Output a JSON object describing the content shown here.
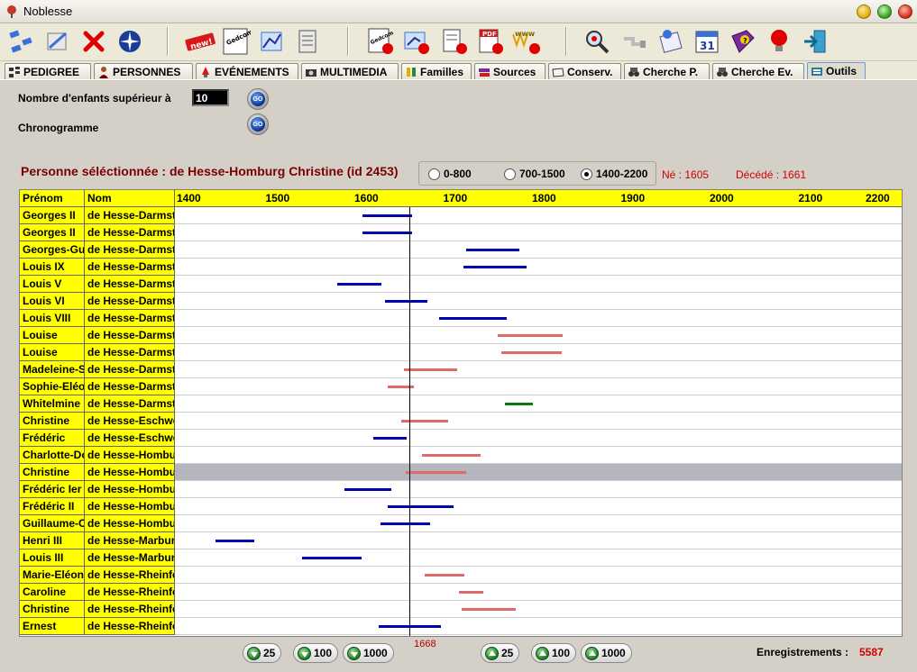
{
  "window": {
    "title": "Noblesse"
  },
  "colors": {
    "male": "#0000b4",
    "female": "#e06a6a",
    "unknown": "#0a7a0a",
    "header": "#ffff00",
    "highlight": "#b5b5bd"
  },
  "toolbar": {
    "icons": [
      "network-icon",
      "edit-tree-icon",
      "delete-icon",
      "compass-icon",
      "new-icon",
      "gedcom-icon",
      "chart-icon",
      "document-edit-icon",
      "gedcom-export-icon",
      "gedcom-import-icon",
      "print-icon",
      "pdf-icon",
      "www-icon",
      "search-icon",
      "link-icon",
      "note-icon",
      "calendar-icon",
      "help-book-icon",
      "tip-icon",
      "exit-icon"
    ],
    "new_label": "new!",
    "gedcom_label": "Gedcom",
    "pdf_label": "PDF",
    "www_label": "www",
    "calendar_label": "31"
  },
  "tabs": [
    {
      "label": "PEDIGREE",
      "icon": "pedigree-icon"
    },
    {
      "label": "PERSONNES",
      "icon": "person-icon"
    },
    {
      "label": "EVÉNEMENTS",
      "icon": "event-icon"
    },
    {
      "label": "MULTIMEDIA",
      "icon": "camera-icon"
    },
    {
      "label": "Familles",
      "icon": "family-icon"
    },
    {
      "label": "Sources",
      "icon": "books-icon"
    },
    {
      "label": "Conserv.",
      "icon": "folder-icon"
    },
    {
      "label": "Cherche P.",
      "icon": "binoculars-icon"
    },
    {
      "label": "Cherche Ev.",
      "icon": "binoculars-icon"
    },
    {
      "label": "Outils",
      "icon": "tools-icon",
      "active": true
    }
  ],
  "tools": {
    "children_label": "Nombre d'enfants supérieur à",
    "children_value": "10",
    "go_label": "GO",
    "chrono_label": "Chronogramme"
  },
  "selection": {
    "title": "Personne séléctionnée : de Hesse-Homburg Christine (id 2453)",
    "ranges": [
      {
        "label": "0-800",
        "checked": false
      },
      {
        "label": "700-1500",
        "checked": false
      },
      {
        "label": "1400-2200",
        "checked": true
      }
    ],
    "born": "Né : 1605",
    "died": "Décédé : 1661"
  },
  "chart_data": {
    "type": "gantt",
    "columns": {
      "first_name": "Prénom",
      "last_name": "Nom"
    },
    "xlim": [
      1400,
      2200
    ],
    "ticks": [
      1400,
      1500,
      1600,
      1700,
      1800,
      1900,
      2000,
      2100,
      2200
    ],
    "marker": {
      "year": 1658,
      "label": "1668"
    },
    "highlight_row": 15,
    "rows": [
      {
        "first": "Georges II",
        "last": "de Hesse-Darmst",
        "start": 1605,
        "end": 1661,
        "sex": "male"
      },
      {
        "first": "Georges II",
        "last": "de Hesse-Darmst",
        "start": 1605,
        "end": 1661,
        "sex": "male"
      },
      {
        "first": "Georges-Gu",
        "last": "de Hesse-Darmst",
        "start": 1722,
        "end": 1782,
        "sex": "male"
      },
      {
        "first": "Louis IX",
        "last": "de Hesse-Darmst",
        "start": 1719,
        "end": 1790,
        "sex": "male"
      },
      {
        "first": "Louis V",
        "last": "de Hesse-Darmst",
        "start": 1577,
        "end": 1626,
        "sex": "male"
      },
      {
        "first": "Louis VI",
        "last": "de Hesse-Darmst",
        "start": 1630,
        "end": 1678,
        "sex": "male"
      },
      {
        "first": "Louis VIII",
        "last": "de Hesse-Darmst",
        "start": 1691,
        "end": 1768,
        "sex": "male"
      },
      {
        "first": "Louise",
        "last": "de Hesse-Darmst",
        "start": 1757,
        "end": 1830,
        "sex": "female"
      },
      {
        "first": "Louise",
        "last": "de Hesse-Darmst",
        "start": 1761,
        "end": 1829,
        "sex": "female"
      },
      {
        "first": "Madeleine-S",
        "last": "de Hesse-Darmst",
        "start": 1652,
        "end": 1712,
        "sex": "female"
      },
      {
        "first": "Sophie-Eléo",
        "last": "de Hesse-Darmst",
        "start": 1634,
        "end": 1663,
        "sex": "female"
      },
      {
        "first": "Whitelmine",
        "last": "de Hesse-Darmst",
        "start": 1765,
        "end": 1797,
        "sex": "unknown"
      },
      {
        "first": "Christine",
        "last": "de Hesse-Eschwe",
        "start": 1649,
        "end": 1702,
        "sex": "female"
      },
      {
        "first": "Frédéric",
        "last": "de Hesse-Eschwe",
        "start": 1617,
        "end": 1655,
        "sex": "male"
      },
      {
        "first": "Charlotte-Do",
        "last": "de Hesse-Hombu",
        "start": 1672,
        "end": 1738,
        "sex": "female"
      },
      {
        "first": "Christine",
        "last": "de Hesse-Hombu",
        "start": 1654,
        "end": 1722,
        "sex": "female"
      },
      {
        "first": "Frédéric Ier",
        "last": "de Hesse-Hombu",
        "start": 1585,
        "end": 1638,
        "sex": "male"
      },
      {
        "first": "Frédéric II",
        "last": "de Hesse-Hombu",
        "start": 1633,
        "end": 1708,
        "sex": "male"
      },
      {
        "first": "Guillaume-C",
        "last": "de Hesse-Hombu",
        "start": 1625,
        "end": 1681,
        "sex": "male"
      },
      {
        "first": "Henri III",
        "last": "de Hesse-Marbur",
        "start": 1440,
        "end": 1483,
        "sex": "male"
      },
      {
        "first": "Louis III",
        "last": "de Hesse-Marbur",
        "start": 1537,
        "end": 1604,
        "sex": "male"
      },
      {
        "first": "Marie-Eléon",
        "last": "de Hesse-Rheinfe",
        "start": 1675,
        "end": 1720,
        "sex": "female"
      },
      {
        "first": "Caroline",
        "last": "de Hesse-Rheinfe",
        "start": 1714,
        "end": 1741,
        "sex": "female"
      },
      {
        "first": "Christine",
        "last": "de Hesse-Rheinfe",
        "start": 1717,
        "end": 1778,
        "sex": "female"
      },
      {
        "first": "Ernest",
        "last": "de Hesse-Rheinfe",
        "start": 1623,
        "end": 1693,
        "sex": "male"
      }
    ]
  },
  "navigation": {
    "down": [
      "25",
      "100",
      "1000"
    ],
    "up": [
      "25",
      "100",
      "1000"
    ]
  },
  "records": {
    "label": "Enregistrements :",
    "value": "5587"
  }
}
